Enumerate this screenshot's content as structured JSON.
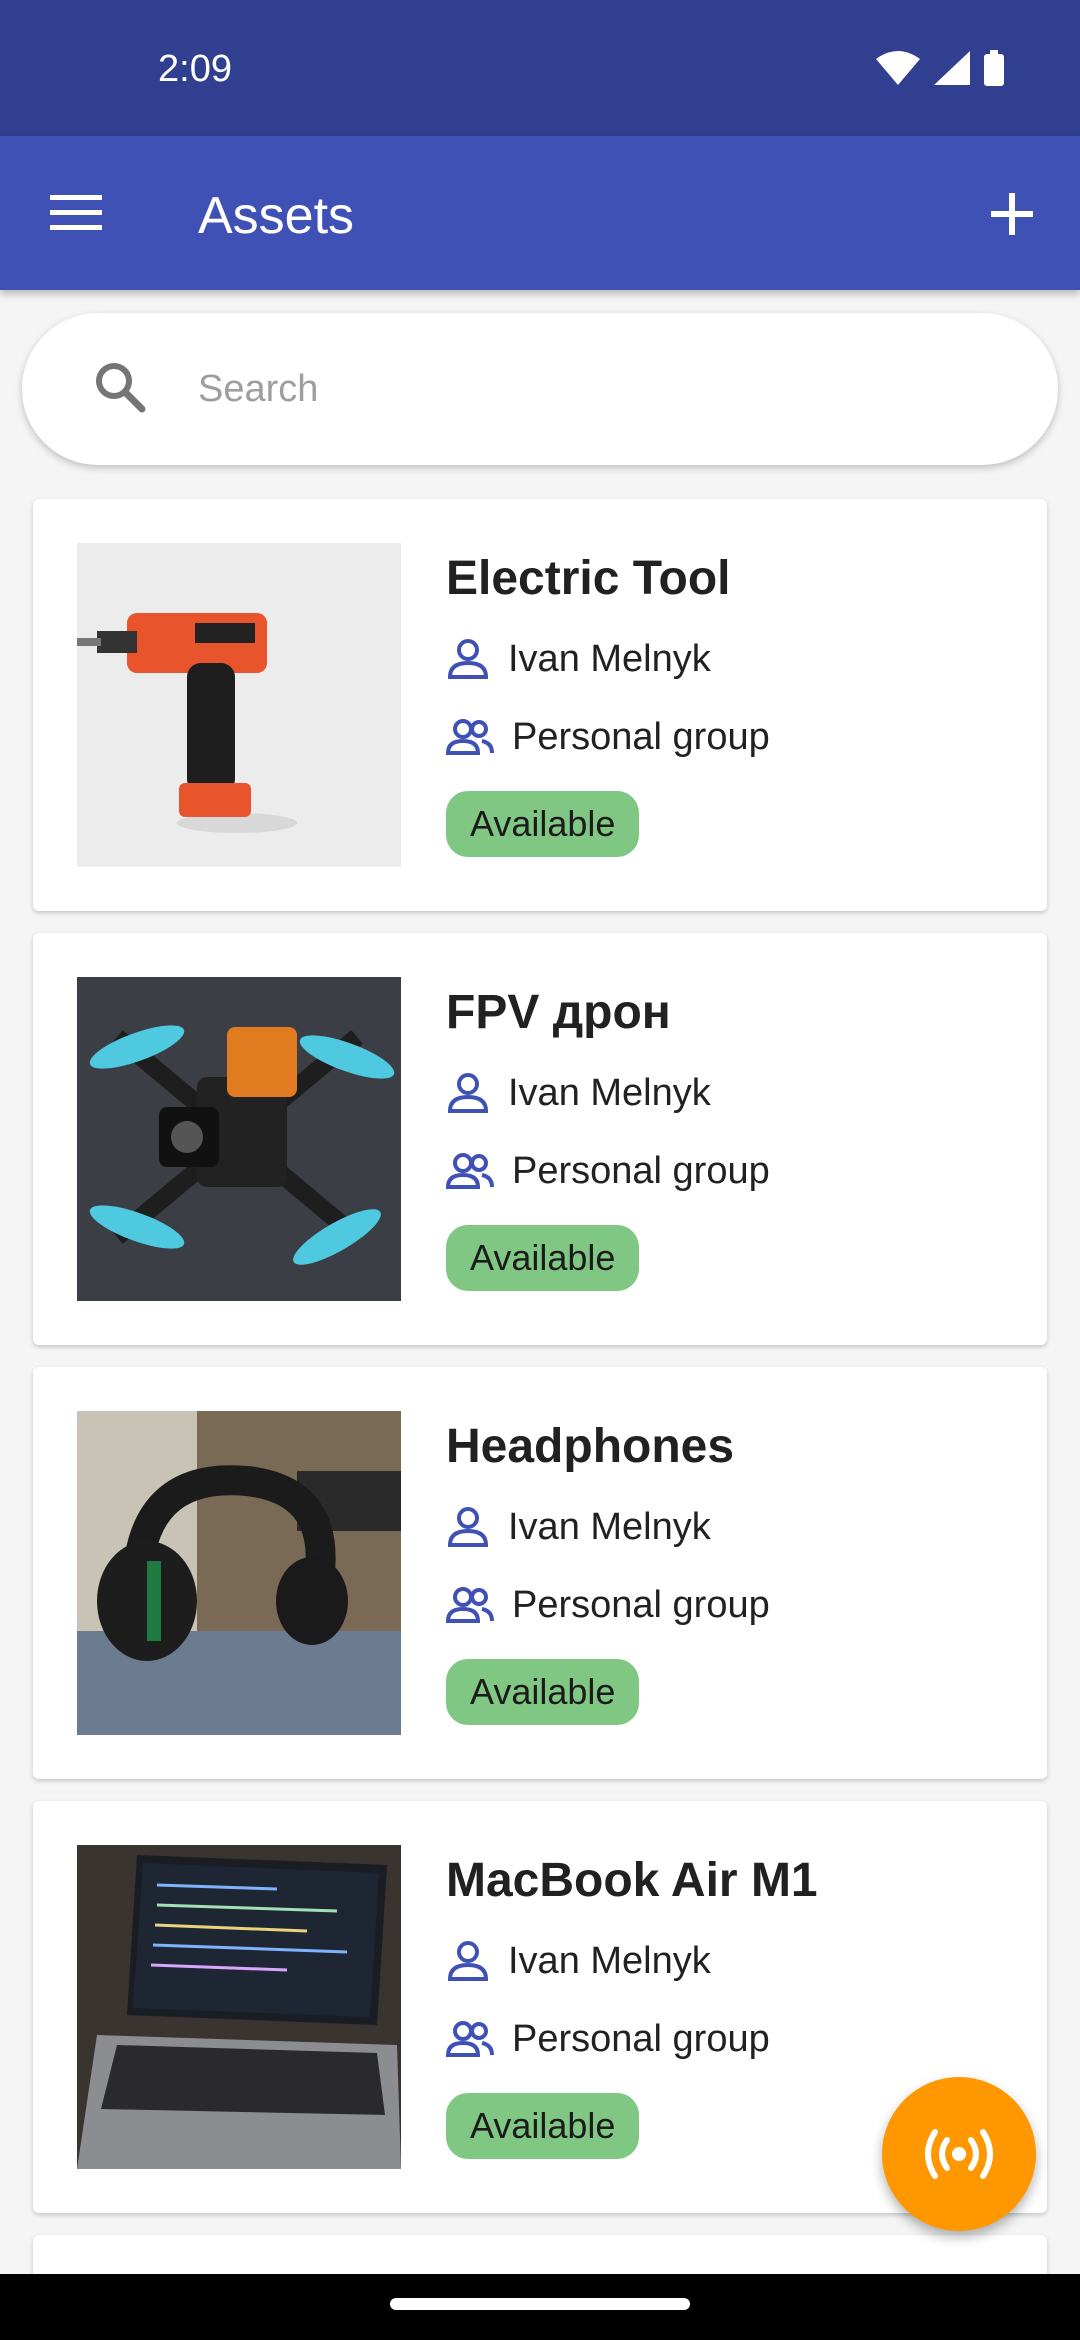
{
  "status_bar": {
    "time": "2:09",
    "icons": [
      "wifi-icon",
      "signal-icon",
      "battery-icon"
    ]
  },
  "app_bar": {
    "title": "Assets",
    "menu_icon": "menu-icon",
    "add_icon": "plus-icon"
  },
  "search": {
    "placeholder": "Search",
    "value": "",
    "icon": "search-icon"
  },
  "assets": [
    {
      "name": "Electric Tool",
      "owner": "Ivan Melnyk",
      "group": "Personal group",
      "status": "Available"
    },
    {
      "name": "FPV дрон",
      "owner": "Ivan Melnyk",
      "group": "Personal group",
      "status": "Available"
    },
    {
      "name": "Headphones",
      "owner": "Ivan Melnyk",
      "group": "Personal group",
      "status": "Available"
    },
    {
      "name": "MacBook Air M1",
      "owner": "Ivan Melnyk",
      "group": "Personal group",
      "status": "Available"
    }
  ],
  "fab": {
    "icon": "broadcast-icon"
  },
  "colors": {
    "status_bar": "#303f8f",
    "app_bar": "#3f51b5",
    "icon_accent": "#3f51b5",
    "badge_available": "#81c784",
    "fab": "#ff9800"
  }
}
